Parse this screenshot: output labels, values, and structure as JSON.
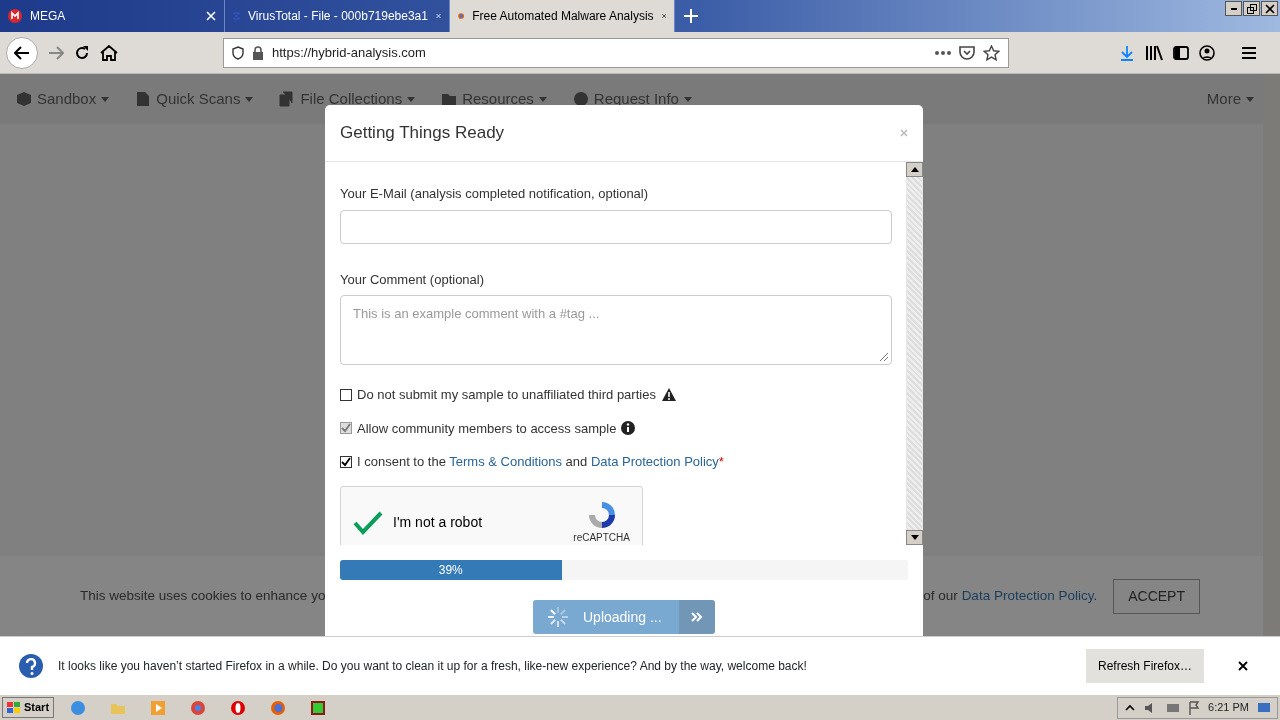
{
  "browser": {
    "tabs": [
      {
        "title": "MEGA",
        "selected": false
      },
      {
        "title": "VirusTotal - File - 000b719ebe3a1",
        "selected": false
      },
      {
        "title": "Free Automated Malware Analysis",
        "selected": true
      }
    ],
    "url_scheme": "https://",
    "url_host": "hybrid-analysis.com"
  },
  "site_nav": {
    "items": [
      {
        "label": "Sandbox"
      },
      {
        "label": "Quick Scans"
      },
      {
        "label": "File Collections"
      },
      {
        "label": "Resources"
      },
      {
        "label": "Request Info"
      }
    ],
    "more": "More"
  },
  "modal": {
    "title": "Getting Things Ready",
    "fields": [
      {
        "kind": "input",
        "label": "Your E-Mail (analysis completed notification, optional)"
      },
      {
        "kind": "textarea",
        "label": "Your Comment (optional)",
        "placeholder": "This is an example comment with a #tag ..."
      }
    ],
    "checkboxes": [
      {
        "checked": false,
        "disabled": false,
        "parts": [
          {
            "kind": "text",
            "text": "Do not submit my sample to unaffiliated third parties"
          }
        ]
      },
      {
        "checked": true,
        "disabled": true,
        "parts": [
          {
            "kind": "text",
            "text": "Allow community members to access sample"
          }
        ]
      },
      {
        "checked": true,
        "disabled": false,
        "parts": [
          {
            "kind": "text",
            "text": "I consent to the "
          },
          {
            "kind": "link",
            "text": "Terms & Conditions"
          },
          {
            "kind": "text",
            "text": " and "
          },
          {
            "kind": "link",
            "text": "Data Protection Policy"
          },
          {
            "kind": "required",
            "text": "*"
          }
        ]
      }
    ],
    "captcha": {
      "checked": true,
      "label": "I'm not a robot",
      "brand": "reCAPTCHA"
    },
    "progress": {
      "level": 0.39,
      "label": "39%"
    },
    "submit": {
      "label": "Uploading ...",
      "disabled": true
    }
  },
  "cookie_bar": {
    "text_start": "This website uses cookies to enhance yo",
    "text_end": "of our ",
    "link": "Data Protection Policy",
    "end": ".",
    "button": "ACCEPT"
  },
  "notification": {
    "text": "It looks like you haven’t started Firefox in a while. Do you want to clean it up for a fresh, like-new experience? And by the way, welcome back!",
    "button": "Refresh Firefox…"
  },
  "taskbar": {
    "start": "Start",
    "time": "6:21 PM"
  }
}
